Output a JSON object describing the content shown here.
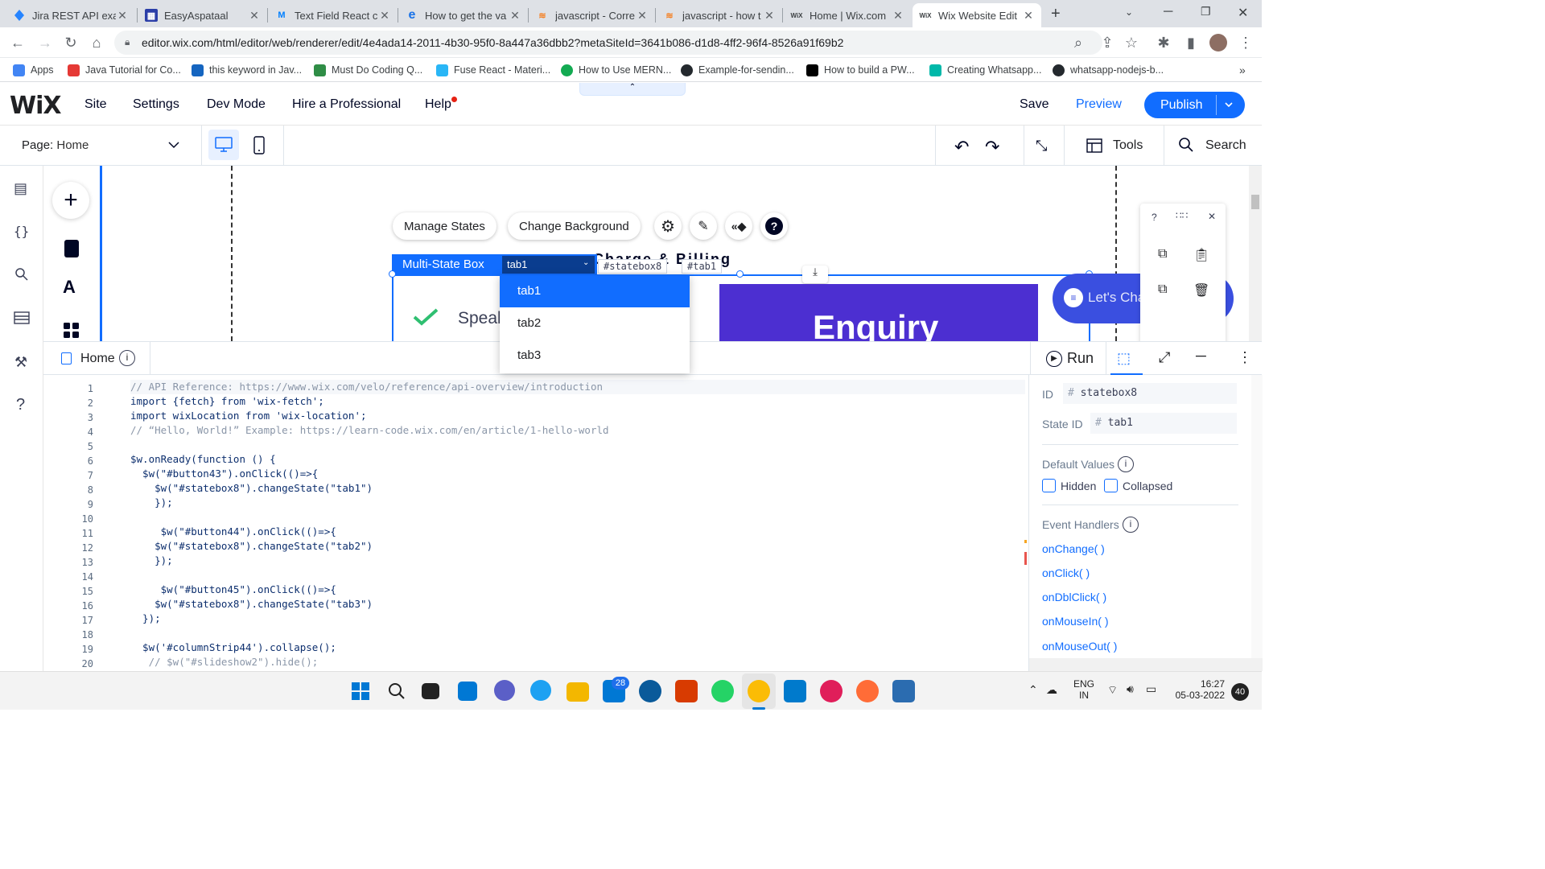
{
  "browser": {
    "tabs": [
      {
        "title": "Jira REST API exar",
        "icon": "jira-icon",
        "color": "#2684ff"
      },
      {
        "title": "EasyAspataal",
        "icon": "jira-board-icon",
        "color": "#2b3ea8"
      },
      {
        "title": "Text Field React c",
        "icon": "mui-icon",
        "color": "#007fff"
      },
      {
        "title": "How to get the va",
        "icon": "e-icon",
        "color": "#1a73e8"
      },
      {
        "title": "javascript - Corre",
        "icon": "stackoverflow-icon",
        "color": "#f48024"
      },
      {
        "title": "javascript - how t",
        "icon": "stackoverflow-icon",
        "color": "#f48024"
      },
      {
        "title": "Home | Wix.com",
        "icon": "wix-icon",
        "color": "#000000"
      },
      {
        "title": "Wix Website Edit",
        "icon": "wix-icon",
        "color": "#000000"
      }
    ],
    "url": "editor.wix.com/html/editor/web/renderer/edit/4e4ada14-2011-4b30-95f0-8a447a36dbb2?metaSiteId=3641b086-d1d8-4ff2-96f4-8526a91f69b2",
    "bookmarks": [
      {
        "label": "Apps",
        "icon": "apps-grid-icon",
        "color": "#4285f4"
      },
      {
        "label": "Java Tutorial for Co...",
        "icon": "java-icon",
        "color": "#e53935"
      },
      {
        "label": "this keyword in Jav...",
        "icon": "t-icon",
        "color": "#1565c0"
      },
      {
        "label": "Must Do Coding Q...",
        "icon": "gfg-icon",
        "color": "#2f8d46"
      },
      {
        "label": "Fuse React - Materi...",
        "icon": "fuse-icon",
        "color": "#29b6f6"
      },
      {
        "label": "How to Use MERN...",
        "icon": "mongodb-icon",
        "color": "#13aa52"
      },
      {
        "label": "Example-for-sendin...",
        "icon": "github-icon",
        "color": "#24292e"
      },
      {
        "label": "How to build a PW...",
        "icon": "dev-icon",
        "color": "#000000"
      },
      {
        "label": "Creating Whatsapp...",
        "icon": "c-icon",
        "color": "#00b8a9"
      },
      {
        "label": "whatsapp-nodejs-b...",
        "icon": "github-icon",
        "color": "#24292e"
      }
    ]
  },
  "wix": {
    "logo": "WiX",
    "menu": [
      "Site",
      "Settings",
      "Dev Mode",
      "Hire a Professional",
      "Help"
    ],
    "save": "Save",
    "preview": "Preview",
    "publish": "Publish",
    "page_label": "Page:",
    "page_value": "Home",
    "tools": "Tools",
    "search": "Search"
  },
  "canvas": {
    "manage_states": "Manage States",
    "change_background": "Change Background",
    "msb_label": "Multi-State Box",
    "msb_selected": "tab1",
    "id_tag": "#statebox8",
    "state_tag": "#tab1",
    "heading_fragment": "Charge & Billing",
    "speak_text": "Speal",
    "enquiry_text": "Enquiry",
    "chat_text": "Let's Chat!",
    "dropdown_options": [
      "tab1",
      "tab2",
      "tab3"
    ]
  },
  "code_panel": {
    "file": "Home",
    "run": "Run",
    "lines": [
      {
        "n": "1",
        "text": "// API Reference: https://www.wix.com/velo/reference/api-overview/introduction"
      },
      {
        "n": "2",
        "text": "import {fetch} from 'wix-fetch';"
      },
      {
        "n": "3",
        "text": "import wixLocation from 'wix-location';"
      },
      {
        "n": "4",
        "text": "// “Hello, World!” Example: https://learn-code.wix.com/en/article/1-hello-world"
      },
      {
        "n": "5",
        "text": ""
      },
      {
        "n": "6",
        "text": "$w.onReady(function () {"
      },
      {
        "n": "7",
        "text": "  $w(\"#button43\").onClick(()=>{"
      },
      {
        "n": "8",
        "text": "    $w(\"#statebox8\").changeState(\"tab1\")"
      },
      {
        "n": "9",
        "text": "    });"
      },
      {
        "n": "10",
        "text": ""
      },
      {
        "n": "11",
        "text": "     $w(\"#button44\").onClick(()=>{"
      },
      {
        "n": "12",
        "text": "    $w(\"#statebox8\").changeState(\"tab2\")"
      },
      {
        "n": "13",
        "text": "    });"
      },
      {
        "n": "14",
        "text": ""
      },
      {
        "n": "15",
        "text": "     $w(\"#button45\").onClick(()=>{"
      },
      {
        "n": "16",
        "text": "    $w(\"#statebox8\").changeState(\"tab3\")"
      },
      {
        "n": "17",
        "text": "  });"
      },
      {
        "n": "18",
        "text": ""
      },
      {
        "n": "19",
        "text": "  $w('#columnStrip44').collapse();"
      },
      {
        "n": "20",
        "text": "   // $w(\"#slideshow2\").hide();"
      }
    ]
  },
  "properties": {
    "id_label": "ID",
    "id_value": "statebox8",
    "state_id_label": "State ID",
    "state_id_value": "tab1",
    "default_values": "Default Values",
    "hidden": "Hidden",
    "collapsed": "Collapsed",
    "event_handlers": "Event Handlers",
    "handlers": [
      "onChange( )",
      "onClick( )",
      "onDblClick( )",
      "onMouseIn( )",
      "onMouseOut( )"
    ]
  },
  "taskbar": {
    "lang_top": "ENG",
    "lang_bottom": "IN",
    "time": "16:27",
    "date": "05-03-2022",
    "teams_badge": "28",
    "notif_count": "40"
  },
  "colors": {
    "wix_blue": "#116dff",
    "enquiry_purple": "#4c2fd1",
    "chat_blue": "#3a4fe0",
    "check_green": "#2fbf71"
  }
}
